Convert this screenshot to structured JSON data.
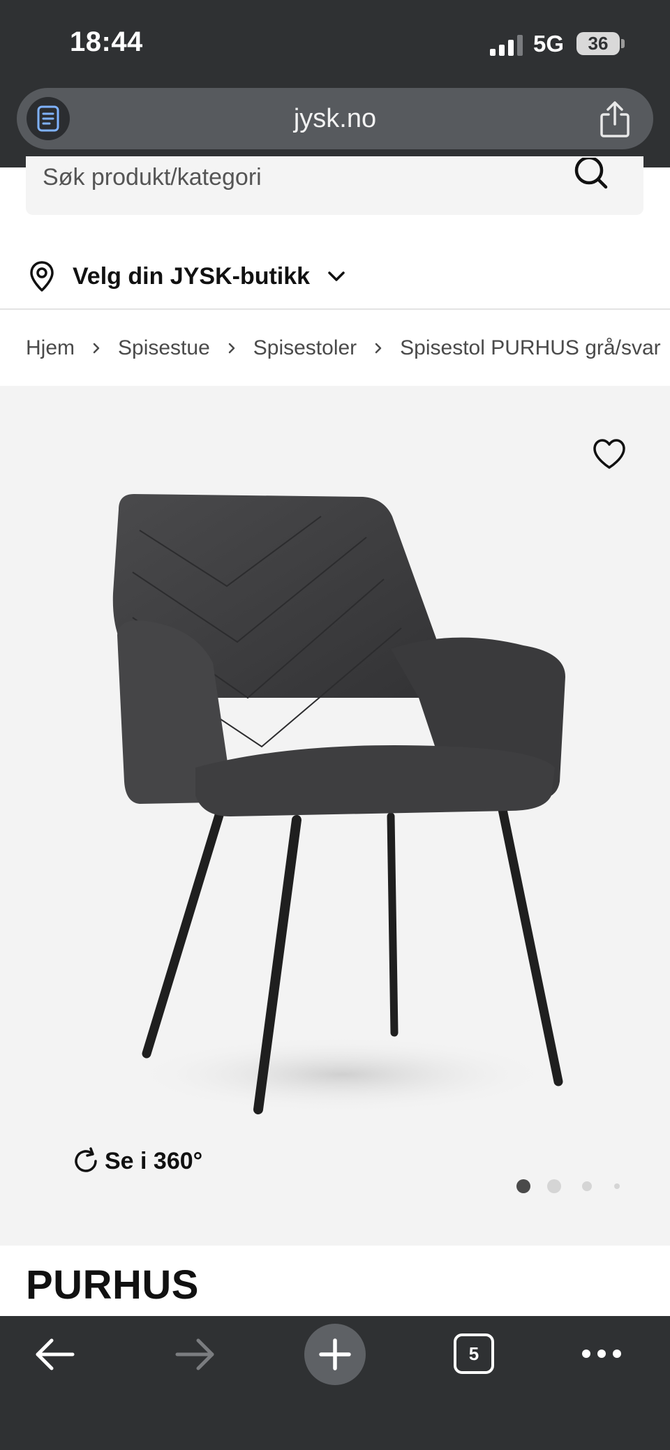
{
  "status_bar": {
    "time": "18:44",
    "network": "5G",
    "battery": "36"
  },
  "browser": {
    "url": "jysk.no",
    "tabs_count": "5"
  },
  "search": {
    "placeholder": "Søk produkt/kategori"
  },
  "store": {
    "label": "Velg din JYSK-butikk"
  },
  "breadcrumb": {
    "items": [
      "Hjem",
      "Spisestue",
      "Spisestoler",
      "Spisestol PURHUS grå/svar"
    ]
  },
  "gallery": {
    "view360_label": "Se i 360°",
    "slide_count": 4,
    "active_slide": 1
  },
  "product": {
    "title": "PURHUS"
  },
  "colors": {
    "chrome": "#2f3133",
    "gallery_bg": "#f3f3f3"
  }
}
